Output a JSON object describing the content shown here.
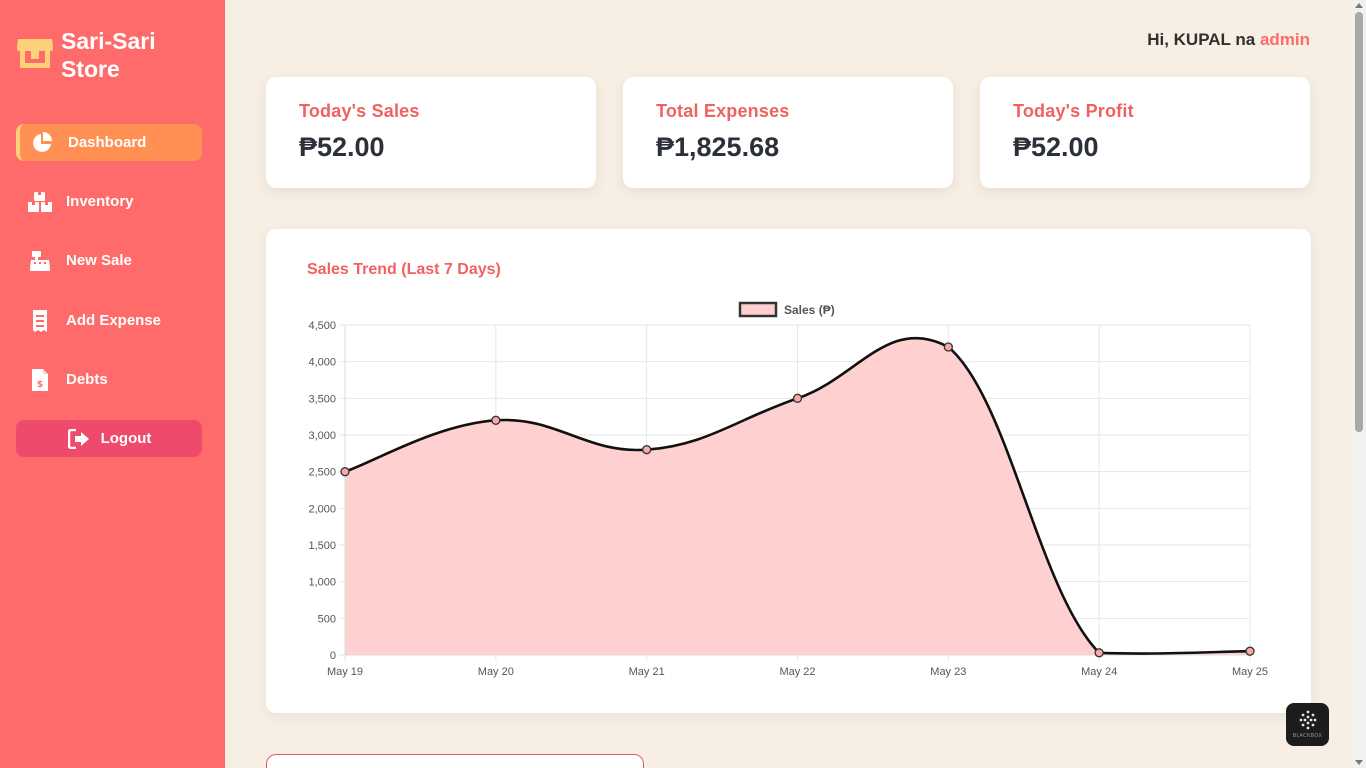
{
  "brand": {
    "title": "Sari-Sari Store",
    "icon": "store-icon",
    "icon_color": "#ffd07a"
  },
  "sidebar": {
    "bg_color": "#ff6b6b",
    "items": [
      {
        "label": "Dashboard",
        "icon": "chart-pie-icon",
        "active": true
      },
      {
        "label": "Inventory",
        "icon": "boxes-icon",
        "active": false
      },
      {
        "label": "New Sale",
        "icon": "cash-register-icon",
        "active": false
      },
      {
        "label": "Add Expense",
        "icon": "receipt-icon",
        "active": false
      },
      {
        "label": "Debts",
        "icon": "invoice-dollar-icon",
        "active": false
      }
    ],
    "logout": {
      "label": "Logout",
      "icon": "sign-out-icon"
    }
  },
  "header": {
    "greeting_prefix": "Hi, KUPAL na",
    "username": "admin"
  },
  "stats": [
    {
      "label": "Today's Sales",
      "value": "₱52.00"
    },
    {
      "label": "Total Expenses",
      "value": "₱1,825.68"
    },
    {
      "label": "Today's Profit",
      "value": "₱52.00"
    }
  ],
  "chart": {
    "title": "Sales Trend (Last 7 Days)"
  },
  "chart_data": {
    "type": "area",
    "x": [
      "May 19",
      "May 20",
      "May 21",
      "May 22",
      "May 23",
      "May 24",
      "May 25"
    ],
    "series": [
      {
        "name": "Sales (₱)",
        "values": [
          2500,
          3200,
          2800,
          3500,
          4200,
          30,
          52
        ],
        "line_color": "#111111",
        "fill_color": "#ffd0d0"
      }
    ],
    "ylim": [
      0,
      4500
    ],
    "yticks": [
      0,
      500,
      1000,
      1500,
      2000,
      2500,
      3000,
      3500,
      4000,
      4500
    ],
    "ytick_labels": [
      "0",
      "500",
      "1,000",
      "1,500",
      "2,000",
      "2,500",
      "3,000",
      "3,500",
      "4,000",
      "4,500"
    ],
    "grid": true,
    "legend": "top-center",
    "title": "Sales Trend (Last 7 Days)"
  },
  "badge": {
    "label": "BLACKBOX"
  },
  "colors": {
    "accent": "#f0625f",
    "active_nav": "#ff8f52",
    "logout": "#ee4a6b",
    "page_bg": "#f7efe4"
  }
}
